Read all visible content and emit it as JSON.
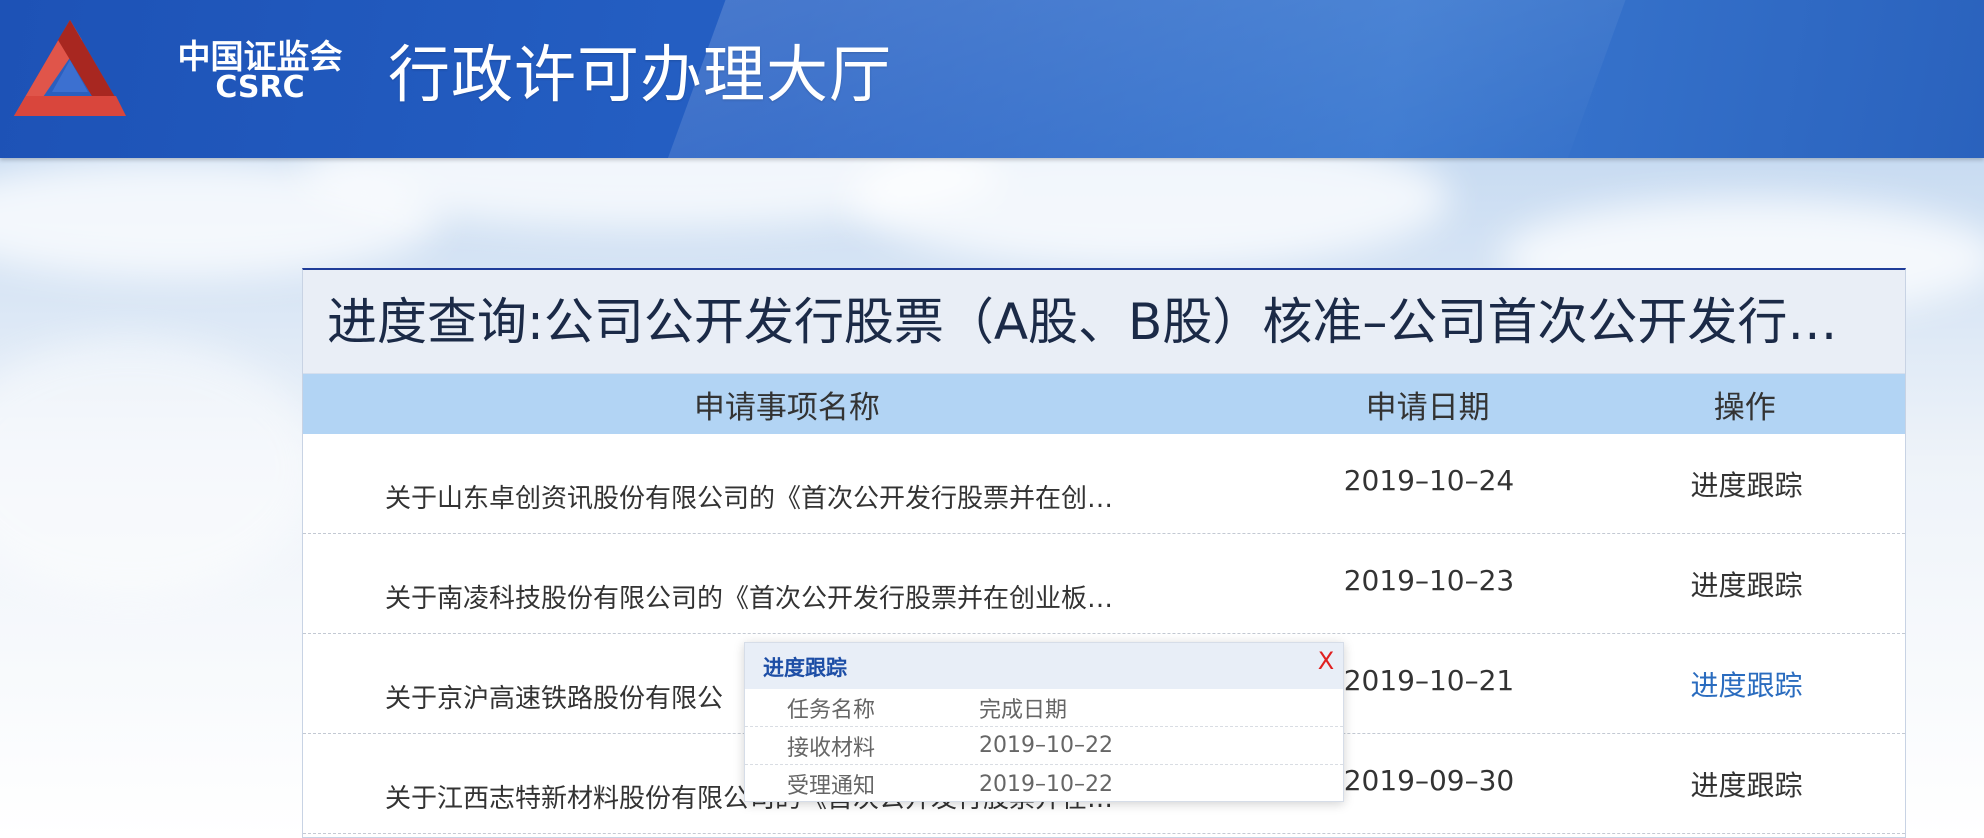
{
  "header": {
    "logo_cn": "中国证监会",
    "logo_en": "CSRC",
    "site_title": "行政许可办理大厅"
  },
  "panel": {
    "title": "进度查询:公司公开发行股票（A股、B股）核准–公司首次公开发行…",
    "columns": {
      "name": "申请事项名称",
      "date": "申请日期",
      "op": "操作"
    },
    "rows": [
      {
        "name": "关于山东卓创资讯股份有限公司的《首次公开发行股票并在创…",
        "date": "2019–10–24",
        "op": "进度跟踪"
      },
      {
        "name": "关于南凌科技股份有限公司的《首次公开发行股票并在创业板…",
        "date": "2019–10–23",
        "op": "进度跟踪"
      },
      {
        "name": "关于京沪高速铁路股份有限公",
        "date": "2019–10–21",
        "op": "进度跟踪"
      },
      {
        "name": "关于江西志特新材料股份有限公司的《首次公开发行股票并在…",
        "date": "2019–09–30",
        "op": "进度跟踪"
      }
    ]
  },
  "popup": {
    "title": "进度跟踪",
    "close": "X",
    "header": {
      "task": "任务名称",
      "date": "完成日期"
    },
    "items": [
      {
        "task": "接收材料",
        "date": "2019–10–22"
      },
      {
        "task": "受理通知",
        "date": "2019–10–22"
      }
    ]
  },
  "colors": {
    "header_blue": "#2560c4",
    "table_head": "#b2d4f4",
    "link_active": "#2a6cbf",
    "close_red": "#e02020"
  }
}
